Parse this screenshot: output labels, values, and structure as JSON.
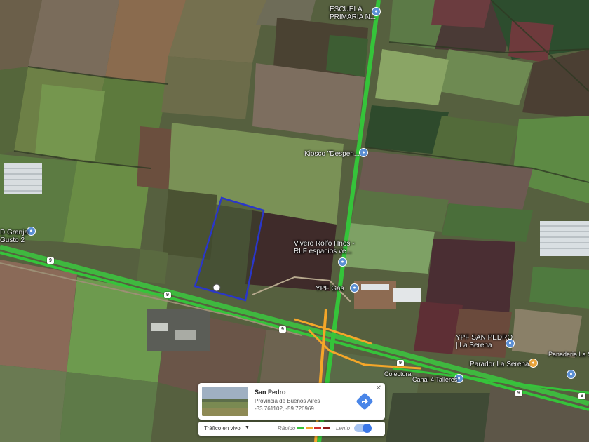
{
  "map": {
    "poi_labels": {
      "escuela": "ESCUELA\nPRIMARIA N...",
      "kiosco": "Kiosco \"Despen...",
      "granja": "D Granja\nGusto 2",
      "vivero": "Vivero Rolfo Hnos -\nRLF espacios ve...",
      "ypf_gas": "YPF Gas",
      "ypf": "YPF SAN PEDRO\n| La Serena",
      "parador": "Parador La Serena",
      "panaderia": "Panaderia La Serena",
      "colectora": "Colectora",
      "canal": "Canal 4 Talleres"
    },
    "route_shields": [
      "9",
      "9",
      "9",
      "9",
      "9",
      "9"
    ],
    "colors": {
      "traffic_fast": "#35c43a",
      "traffic_mid": "#f4a629",
      "traffic_slow": "#d12c2c",
      "polygon": "#2a36c9",
      "pin_blue": "#5b8fd4",
      "pin_orange": "#e8a33a"
    }
  },
  "info_card": {
    "title": "San Pedro",
    "subtitle": "Provincia de Buenos Aires",
    "coordinates": "-33.761102, -59.726969",
    "close_icon": "close-icon",
    "directions_icon": "directions-icon"
  },
  "traffic": {
    "label": "Tráfico en vivo",
    "fast_label": "Rápido",
    "slow_label": "Lento",
    "toggle_on": true
  }
}
